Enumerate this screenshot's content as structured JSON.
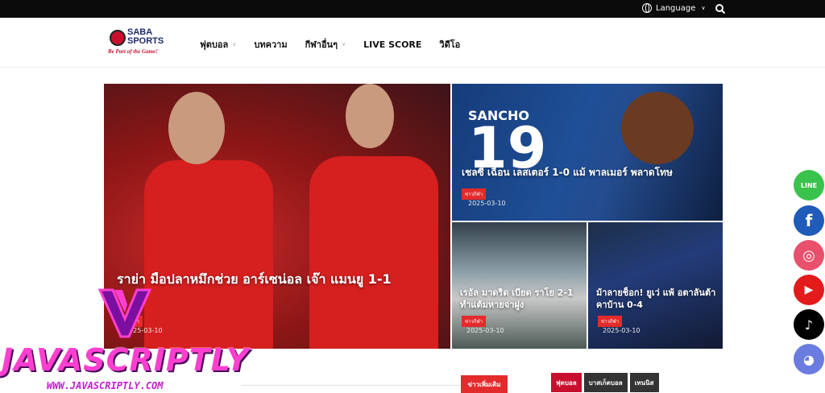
{
  "topbar": {
    "language_label": "Language"
  },
  "logo": {
    "brand_line1": "SABA",
    "brand_line2": "SPORTS",
    "slogan": "Be Part of the Game!"
  },
  "nav": [
    {
      "label": "ฟุตบอล",
      "has_dropdown": true
    },
    {
      "label": "บทความ",
      "has_dropdown": false
    },
    {
      "label": "กีฬาอื่นๆ",
      "has_dropdown": true
    },
    {
      "label": "LIVE SCORE",
      "has_dropdown": false
    },
    {
      "label": "วิดีโอ",
      "has_dropdown": false
    }
  ],
  "articles": {
    "main": {
      "title": "ราย่า มือปลาหมึกช่วย อาร์เซน่อล เจ๊า แมนยู 1-1",
      "tag": "ข่าวกีฬา",
      "date": "2025-03-10"
    },
    "top_right": {
      "title": "เชลซี เฉือน เลสเตอร์ 1-0 แม้ พาลเมอร์ พลาดโทษ",
      "tag": "ข่าวกีฬา",
      "date": "2025-03-10"
    },
    "bottom_left": {
      "title": "เรอัล มาดริด เบียด ราโย 2-1 ทำแต้มหายจ่าฝูง",
      "tag": "ข่าวกีฬา",
      "date": "2025-03-10"
    },
    "bottom_right": {
      "title": "ม้าลายช็อก! ยูเว่ แพ้ อตาลันต้า คาบ้าน 0-4",
      "tag": "ข่าวกีฬา",
      "date": "2025-03-10"
    }
  },
  "social": [
    {
      "name": "LINE",
      "glyph": "LINE",
      "color": "#3ac34c"
    },
    {
      "name": "facebook",
      "glyph": "f",
      "color": "#1f5bb8"
    },
    {
      "name": "instagram",
      "glyph": "◎",
      "color": "#e8506b"
    },
    {
      "name": "youtube",
      "glyph": "▶",
      "color": "#e31b1b"
    },
    {
      "name": "tiktok",
      "glyph": "♪",
      "color": "#000000"
    },
    {
      "name": "discord",
      "glyph": "◕",
      "color": "#6b7ce0"
    }
  ],
  "watermark": {
    "text": "JAVASCRIPTLY",
    "url": "WWW.JAVASCRIPTLY.COM"
  },
  "section": {
    "more_button": "ข่าวเพิ่มเติม",
    "tabs": [
      {
        "label": "ฟุตบอล",
        "active": true
      },
      {
        "label": "บาสเก็ตบอล",
        "active": false
      },
      {
        "label": "เทนนิส",
        "active": false
      }
    ]
  },
  "colors": {
    "accent": "#e32b2b",
    "topbar": "#0b0b0b"
  }
}
